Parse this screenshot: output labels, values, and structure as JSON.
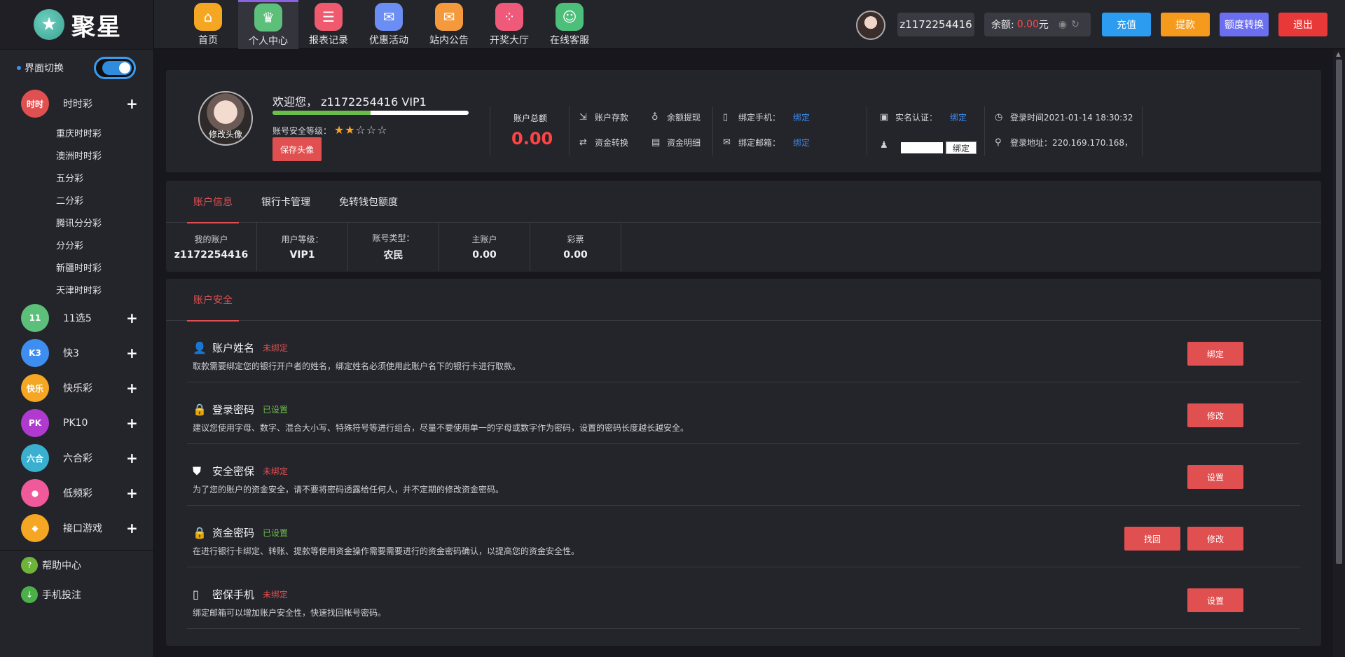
{
  "brand": {
    "name": "聚星"
  },
  "nav": [
    {
      "label": "首页",
      "icon": "home-icon",
      "color": "#f5a623"
    },
    {
      "label": "个人中心",
      "icon": "crown-icon",
      "color": "#5cc07a"
    },
    {
      "label": "报表记录",
      "icon": "report-icon",
      "color": "#f05a6e"
    },
    {
      "label": "优惠活动",
      "icon": "gift-icon",
      "color": "#6b8ef5"
    },
    {
      "label": "站内公告",
      "icon": "mail-icon",
      "color": "#f59a3c"
    },
    {
      "label": "开奖大厅",
      "icon": "grid-icon",
      "color": "#f05a7a"
    },
    {
      "label": "在线客服",
      "icon": "headset-icon",
      "color": "#4cc07a"
    }
  ],
  "user": {
    "name": "z1172254416",
    "balance_label": "余额:",
    "balance": "0.00",
    "currency": "元"
  },
  "top_buttons": {
    "recharge": "充值",
    "withdraw": "提款",
    "transfer": "额度转换",
    "logout": "退出"
  },
  "sidebar": {
    "switch_label": "界面切换",
    "cat_ssc": {
      "label": "时时彩",
      "icon_text": "时时"
    },
    "ssc_subs": [
      "重庆时时彩",
      "澳洲时时彩",
      "五分彩",
      "二分彩",
      "腾讯分分彩",
      "分分彩",
      "新疆时时彩",
      "天津时时彩"
    ],
    "cats": [
      {
        "label": "11选5",
        "icon_text": "11",
        "color": "#5cc07a"
      },
      {
        "label": "快3",
        "icon_text": "K3",
        "color": "#3d8ef0"
      },
      {
        "label": "快乐彩",
        "icon_text": "快乐",
        "color": "#f5a623"
      },
      {
        "label": "PK10",
        "icon_text": "PK",
        "color": "#b03ad0"
      },
      {
        "label": "六合彩",
        "icon_text": "六合",
        "color": "#3ab0d0"
      },
      {
        "label": "低频彩",
        "icon_text": "●",
        "color": "#f05a9a"
      },
      {
        "label": "接口游戏",
        "icon_text": "◆",
        "color": "#f5a623"
      }
    ],
    "help": "帮助中心",
    "mobile": "手机投注"
  },
  "profile": {
    "change_avatar": "修改头像",
    "welcome": "欢迎您， z1172254416 VIP1",
    "security_level_label": "账号安全等级：",
    "security_stars": 2,
    "security_progress": 0.5,
    "save_avatar": "保存头像",
    "total_label": "账户总额",
    "total_value": "0.00",
    "deposit": "账户存款",
    "withdraw": "余额提现",
    "transfer": "资金转换",
    "details": "资金明细",
    "bind_phone_label": "绑定手机：",
    "bind_email_label": "绑定邮箱：",
    "bind_text": "绑定",
    "realname_label": "实名认证：",
    "qq_bind": "绑定",
    "login_time": "登录时间2021-01-14 18:30:32",
    "login_addr": "登录地址：220.169.170.168，"
  },
  "tabs": [
    "账户信息",
    "银行卡管理",
    "免转钱包额度"
  ],
  "info": [
    {
      "label": "我的账户",
      "value": "z1172254416"
    },
    {
      "label": "用户等级：",
      "value": "VIP1"
    },
    {
      "label": "账号类型：",
      "value": "农民"
    },
    {
      "label": "主账户",
      "value": "0.00"
    },
    {
      "label": "彩票",
      "value": "0.00"
    }
  ],
  "security": {
    "tab": "账户安全",
    "rows": [
      {
        "title": "账户姓名",
        "status": "未绑定",
        "desc": "取款需要绑定您的银行开户者的姓名，绑定姓名必须使用此账户名下的银行卡进行取款。",
        "btn": "绑定"
      },
      {
        "title": "登录密码",
        "status": "已设置",
        "desc": "建议您使用字母、数字、混合大小写、特殊符号等进行组合，尽量不要使用单一的字母或数字作为密码，设置的密码长度越长越安全。",
        "btn": "修改"
      },
      {
        "title": "安全密保",
        "status": "未绑定",
        "desc": "为了您的账户的资金安全，请不要将密码透露给任何人，并不定期的修改资金密码。",
        "btn": "设置"
      },
      {
        "title": "资金密码",
        "status": "已设置",
        "desc": "在进行银行卡绑定、转账、提款等使用资金操作需要需要进行的资金密码确认，以提高您的资金安全性。",
        "btn": "修改",
        "btn2": "找回"
      },
      {
        "title": "密保手机",
        "status": "未绑定",
        "desc": "绑定邮箱可以增加账户安全性，快速找回帐号密码。",
        "btn": "设置"
      }
    ]
  },
  "colors": {
    "accent_red": "#e05050",
    "link_blue": "#3d8ef0",
    "ok_green": "#6cbe4a"
  }
}
